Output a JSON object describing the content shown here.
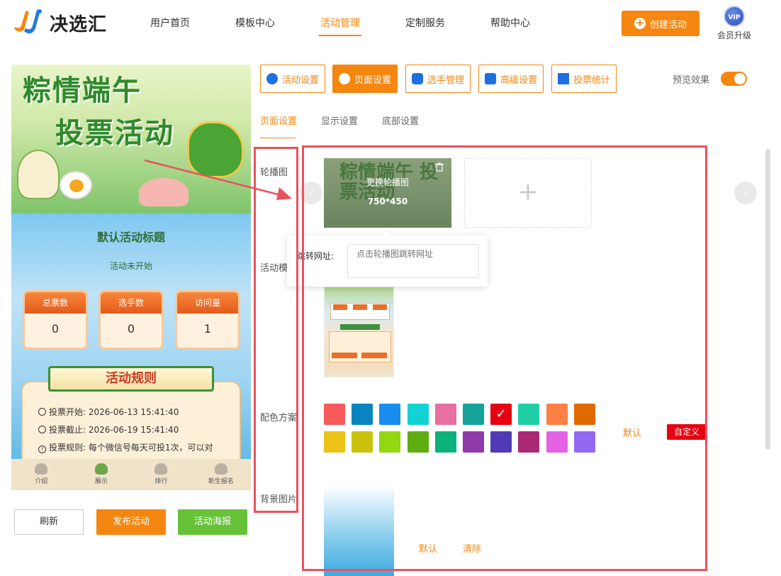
{
  "header": {
    "logo_text": "决选汇",
    "nav": [
      {
        "label": "用户首页",
        "active": false
      },
      {
        "label": "模板中心",
        "active": false
      },
      {
        "label": "活动管理",
        "active": true
      },
      {
        "label": "定制服务",
        "active": false
      },
      {
        "label": "帮助中心",
        "active": false
      }
    ],
    "create_button": "创建活动",
    "vip_badge": "VIP",
    "vip_label": "会员升级"
  },
  "preview": {
    "banner_title_line1": "粽情端午",
    "banner_title_line2": "投票活动",
    "activity_title": "默认活动标题",
    "activity_status": "活动未开始",
    "stats": [
      {
        "label": "总票数",
        "value": "0"
      },
      {
        "label": "选手数",
        "value": "0"
      },
      {
        "label": "访问量",
        "value": "1"
      }
    ],
    "rules_title": "活动规则",
    "rules": [
      {
        "label": "投票开始:",
        "value": "2026-06-13 15:41:40"
      },
      {
        "label": "投票截止:",
        "value": "2026-06-19 15:41:40"
      },
      {
        "label": "投票规则:",
        "value": "每个微信号每天可投1次，可以对"
      }
    ],
    "tabbar": [
      {
        "label": "介绍",
        "active": false
      },
      {
        "label": "展示",
        "active": true
      },
      {
        "label": "排行",
        "active": false
      },
      {
        "label": "新生报名",
        "active": false
      }
    ]
  },
  "actions": {
    "refresh": "刷新",
    "publish": "发布活动",
    "poster": "活动海报"
  },
  "settings": {
    "tabs": [
      {
        "label": "活动设置",
        "icon": "star-icon",
        "active": false
      },
      {
        "label": "页面设置",
        "icon": "gear-icon",
        "active": true
      },
      {
        "label": "选手管理",
        "icon": "users-icon",
        "active": false
      },
      {
        "label": "高级设置",
        "icon": "settings-icon",
        "active": false
      },
      {
        "label": "投票统计",
        "icon": "bar-chart-icon",
        "active": false
      }
    ],
    "preview_label": "预览效果",
    "preview_on": true,
    "subtabs": [
      {
        "label": "页面设置",
        "active": true
      },
      {
        "label": "显示设置",
        "active": false
      },
      {
        "label": "底部设置",
        "active": false
      }
    ],
    "labels": {
      "carousel": "轮播图",
      "template": "活动模",
      "color": "配色方案",
      "background": "背景图片"
    },
    "carousel": {
      "overlay_title": "粽情端午 投票活动",
      "change_text": "更换轮播图",
      "size_text": "750*450",
      "add_symbol": "+"
    },
    "jump": {
      "label": "跳转网址:",
      "placeholder": "点击轮播图跳转网址"
    },
    "template_mini": {
      "title": "默认活动标题"
    },
    "colors": [
      "#f65a5b",
      "#0a84bf",
      "#198cf0",
      "#12d3d3",
      "#e870a0",
      "#14a29a",
      "#e60012",
      "#1fd0a6",
      "#fe8044",
      "#e06a00",
      "#ecc216",
      "#cbc10d",
      "#93d612",
      "#5fae11",
      "#0bb37b",
      "#8e3aab",
      "#513ab6",
      "#a92975",
      "#e462e4",
      "#9568f2"
    ],
    "selected_color": "#e60012",
    "color_default": "默认",
    "color_custom": "自定义",
    "bg_default": "默认",
    "bg_clear": "清除"
  }
}
